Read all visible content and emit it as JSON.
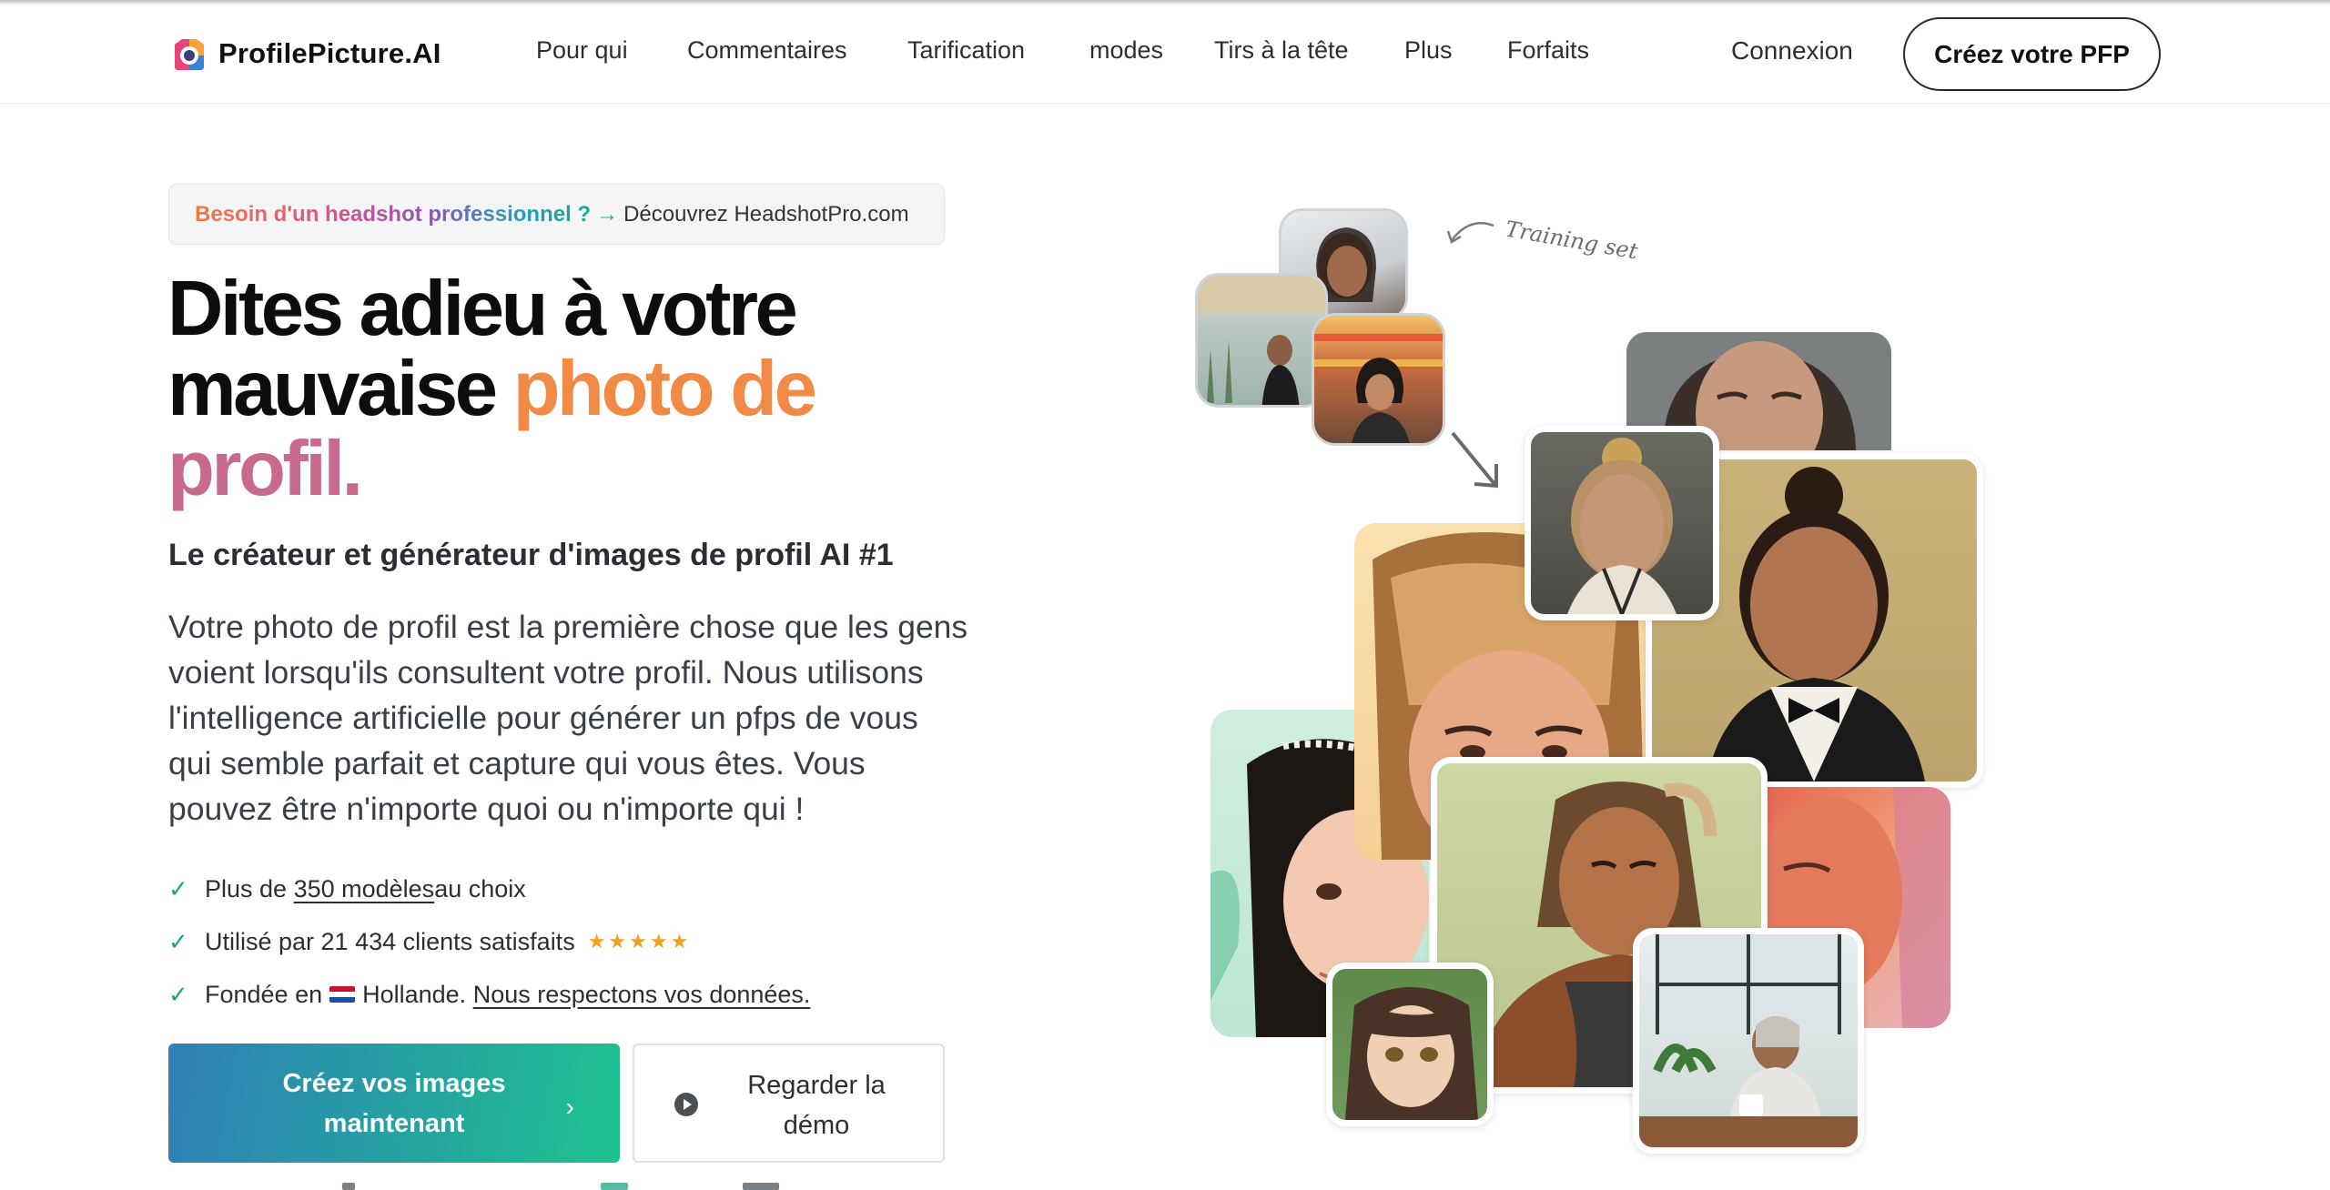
{
  "nav": {
    "logo_text": "ProfilePicture.AI",
    "links": [
      "Pour qui",
      "Commentaires",
      "Tarification",
      "modes",
      "Tirs à la tête",
      "Plus",
      "Forfaits"
    ],
    "login": "Connexion",
    "cta": "Créez votre PFP"
  },
  "banner": {
    "highlight": "Besoin d'un headshot professionnel ?",
    "arrow": "→",
    "rest": "Découvrez HeadshotPro.com"
  },
  "hero": {
    "headline_part1": "Dites adieu à votre mauvaise",
    "headline_part2": "photo de",
    "headline_part3": "profil.",
    "subhead": "Le créateur et générateur d'images de profil AI #1",
    "description": "Votre photo de profil est la première chose que les gens voient lorsqu'ils consultent votre profil. Nous utilisons l'intelligence artificielle pour générer un pfps de vous qui semble parfait et capture qui vous êtes. Vous pouvez être n'importe quoi ou n'importe qui !",
    "features": {
      "f1_prefix": "Plus de",
      "f1_link": "350 modèles ",
      "f1_suffix": "au choix",
      "f2_text": "Utilisé par 21 434 clients satisfaits",
      "f2_stars": "★★★★★",
      "f3_prefix": "Fondée en",
      "f3_mid": "Hollande.",
      "f3_link": "Nous respectons vos données."
    },
    "primary_button": "Créez vos images maintenant",
    "primary_chevron": "›",
    "demo_button": "Regarder la démo"
  },
  "collage": {
    "training_label": "Training set"
  },
  "colors": {
    "accent_teal": "#1ec28e",
    "accent_blue": "#2f7fb6",
    "headline_orange": "#f08a45",
    "headline_pink": "#c86a8e",
    "star": "#f0a023"
  }
}
